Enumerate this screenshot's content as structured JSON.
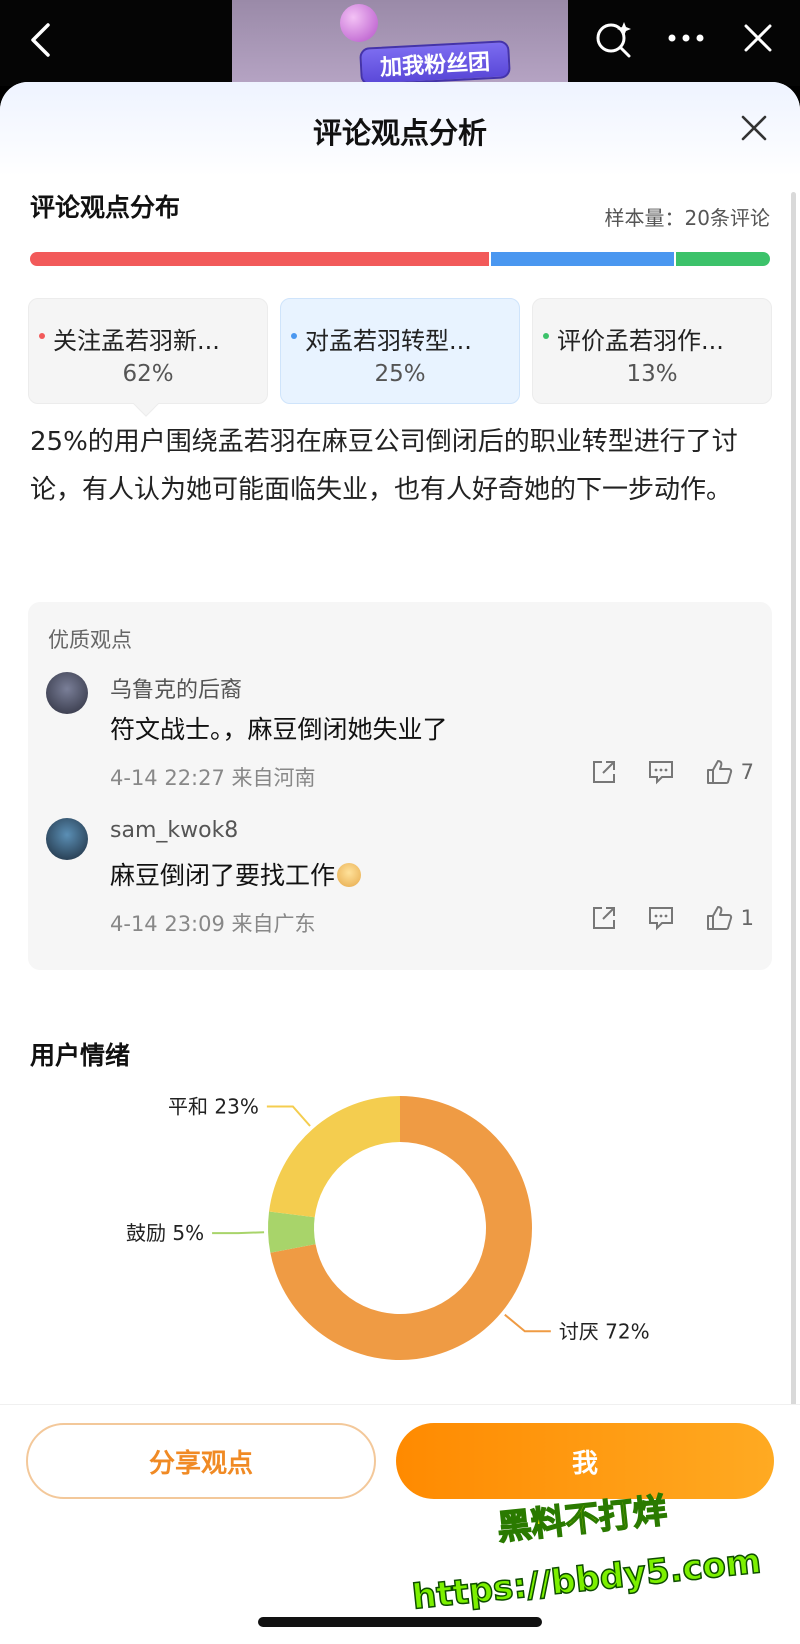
{
  "banner": {
    "chip_text": "加我粉丝团"
  },
  "sheet": {
    "title": "评论观点分析"
  },
  "distribution": {
    "title": "评论观点分布",
    "sample_size": "样本量：20条评论",
    "cards": [
      {
        "label": "关注孟若羽新...",
        "percent": "62%",
        "color": "#f25a5a",
        "value": 62
      },
      {
        "label": "对孟若羽转型...",
        "percent": "25%",
        "color": "#4a97f0",
        "value": 25
      },
      {
        "label": "评价孟若羽作...",
        "percent": "13%",
        "color": "#3cc26a",
        "value": 13
      }
    ],
    "summary": "25%的用户围绕孟若羽在麻豆公司倒闭后的职业转型进行了讨论，有人认为她可能面临失业，也有人好奇她的下一步动作。"
  },
  "quality": {
    "title": "优质观点",
    "comments": [
      {
        "name": "乌鲁克的后裔",
        "text": "符文战士。，麻豆倒闭她失业了",
        "meta": "4-14 22:27 来自河南",
        "likes": "7"
      },
      {
        "name": "sam_kwok8",
        "text": "麻豆倒闭了要找工作",
        "meta": "4-14 23:09 来自广东",
        "likes": "1"
      }
    ]
  },
  "emotion": {
    "title": "用户情绪",
    "chart_data": {
      "type": "pie",
      "title": "用户情绪",
      "slices": [
        {
          "name": "讨厌",
          "value": 72,
          "label": "讨厌 72%",
          "color": "#ef9b44"
        },
        {
          "name": "鼓励",
          "value": 5,
          "label": "鼓励 5%",
          "color": "#a8d46a"
        },
        {
          "name": "平和",
          "value": 23,
          "label": "平和 23%",
          "color": "#f4cd4f"
        }
      ]
    }
  },
  "footer": {
    "share_label": "分享观点",
    "main_label": "我"
  },
  "watermark": {
    "line1": "黑料不打烊",
    "line2": "https://bbdy5.com"
  }
}
